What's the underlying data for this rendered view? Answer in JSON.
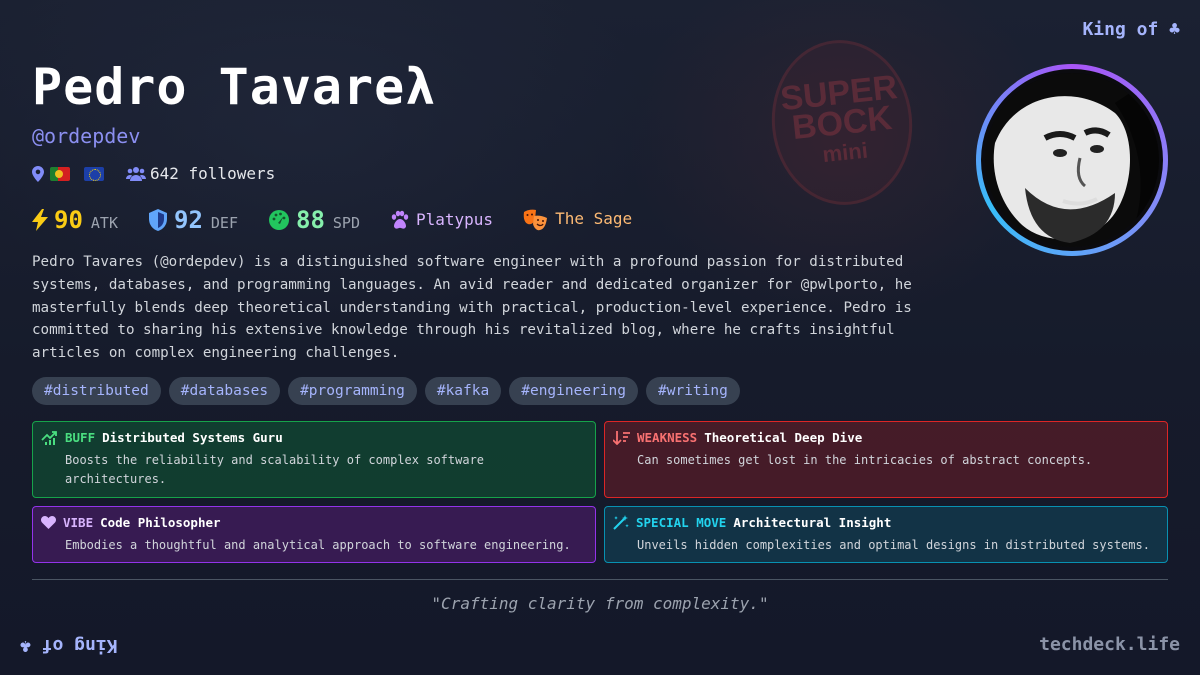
{
  "corner": {
    "suit_label": "King of ♣",
    "site": "techdeck.life"
  },
  "profile": {
    "name": "Pedro Tavareλ",
    "handle": "@ordepdev",
    "flags": [
      "Portugal",
      "European Union"
    ],
    "followers": "642 followers"
  },
  "stats": {
    "atk": {
      "value": "90",
      "unit": "ATK",
      "color": "#facc15"
    },
    "def": {
      "value": "92",
      "unit": "DEF",
      "color": "#93c5fd"
    },
    "spd": {
      "value": "88",
      "unit": "SPD",
      "color": "#86efac"
    },
    "spirit_animal": {
      "label": "Platypus",
      "color": "#d8b4fe"
    },
    "archetype": {
      "label": "The Sage",
      "color": "#fdba74"
    }
  },
  "bio": "Pedro Tavares (@ordepdev) is a distinguished software engineer with a profound passion for distributed systems, databases, and programming languages. An avid reader and dedicated organizer for @pwlporto, he masterfully blends deep theoretical understanding with practical, production-level experience. Pedro is committed to sharing his extensive knowledge through his revitalized blog, where he crafts insightful articles on complex engineering challenges.",
  "tags": [
    "#distributed",
    "#databases",
    "#programming",
    "#kafka",
    "#engineering",
    "#writing"
  ],
  "cards": {
    "buff": {
      "kind": "BUFF",
      "title": "Distributed Systems Guru",
      "desc": "Boosts the reliability and scalability of complex software architectures.",
      "color": "#4ade80"
    },
    "weakness": {
      "kind": "WEAKNESS",
      "title": "Theoretical Deep Dive",
      "desc": "Can sometimes get lost in the intricacies of abstract concepts.",
      "color": "#f87171"
    },
    "vibe": {
      "kind": "VIBE",
      "title": "Code Philosopher",
      "desc": "Embodies a thoughtful and analytical approach to software engineering.",
      "color": "#d8b4fe"
    },
    "special": {
      "kind": "SPECIAL MOVE",
      "title": "Architectural Insight",
      "desc": "Unveils hidden complexities and optimal designs in distributed systems.",
      "color": "#22d3ee"
    }
  },
  "quote": "\"Crafting clarity from complexity.\"",
  "background_text": {
    "line1": "SUPER",
    "line2": "BOCK",
    "line3": "mini"
  }
}
